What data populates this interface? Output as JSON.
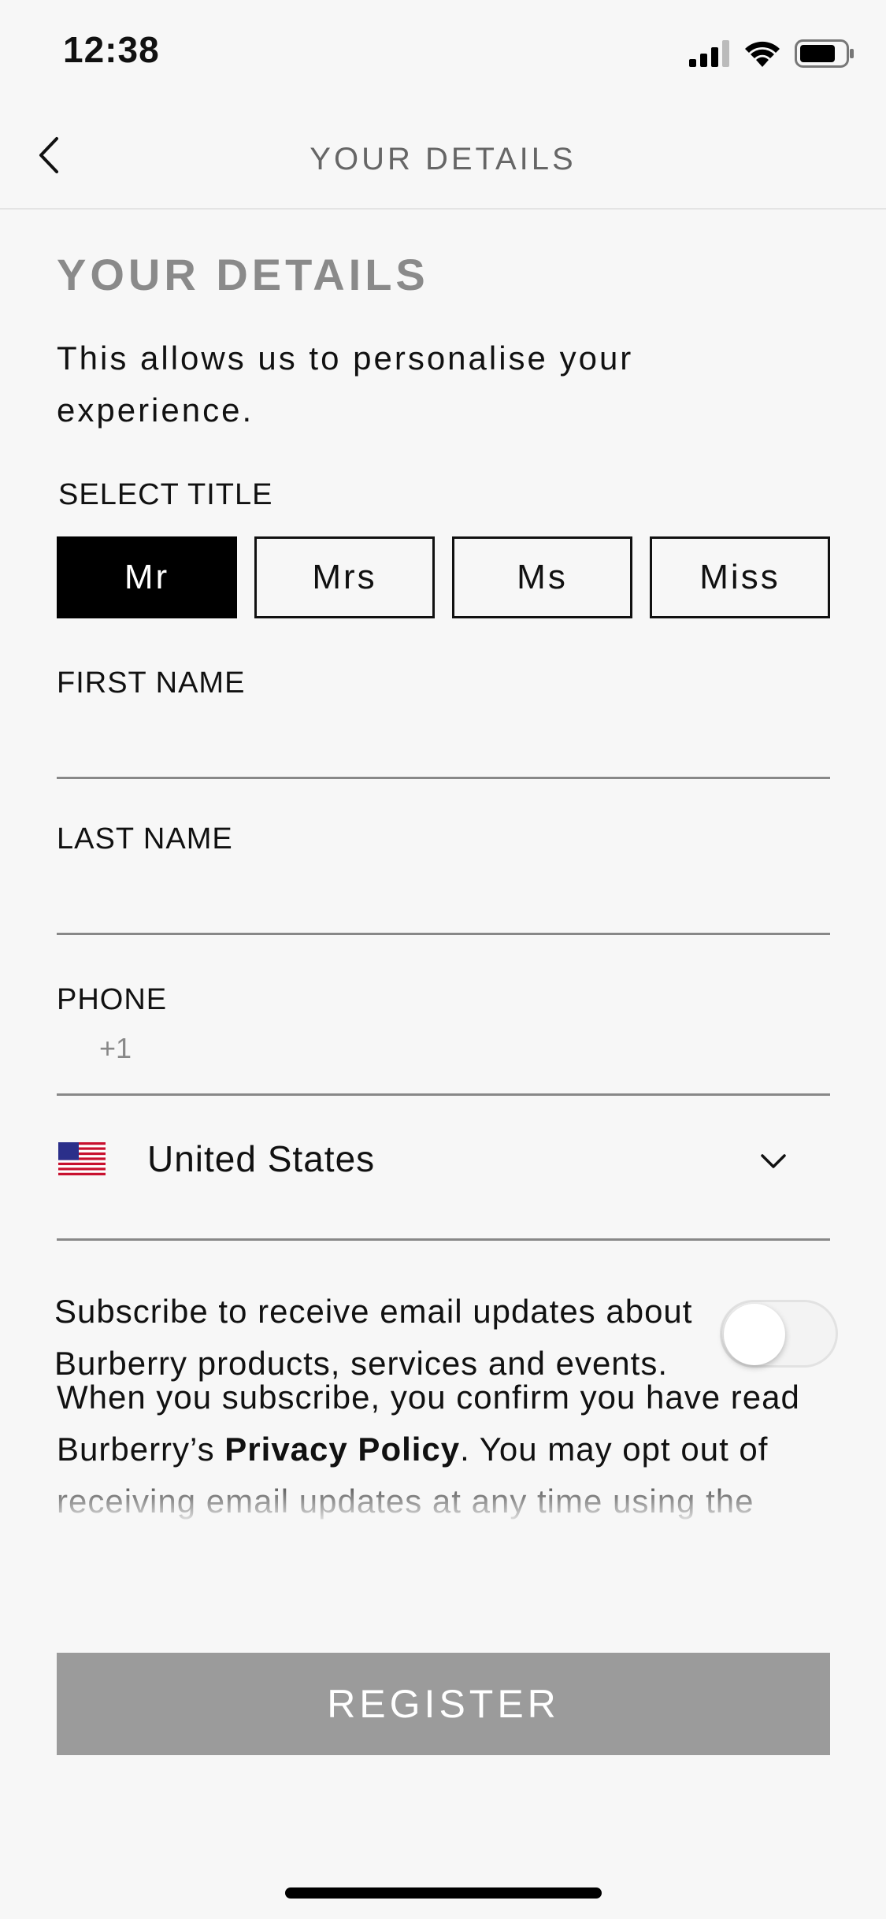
{
  "status_bar": {
    "time": "12:38",
    "icons": [
      "cellular-signal-icon",
      "wifi-icon",
      "battery-icon"
    ]
  },
  "nav": {
    "back_icon": "chevron-left-icon",
    "title": "YOUR DETAILS"
  },
  "form": {
    "heading": "YOUR DETAILS",
    "intro": "This allows us to personalise your experience.",
    "select_title_label": "SELECT TITLE",
    "titles": [
      {
        "label": "Mr",
        "selected": true
      },
      {
        "label": "Mrs",
        "selected": false
      },
      {
        "label": "Ms",
        "selected": false
      },
      {
        "label": "Miss",
        "selected": false
      }
    ],
    "first_name_label": "FIRST NAME",
    "first_name_value": "",
    "last_name_label": "LAST NAME",
    "last_name_value": "",
    "phone_label": "PHONE",
    "phone_prefix": "+1",
    "phone_value": "",
    "country": {
      "flag_icon": "us-flag-icon",
      "name": "United States"
    },
    "subscribe_text": "Subscribe to receive email updates about Burberry products, services and events.",
    "subscribe_enabled": false,
    "privacy": {
      "before": "When you subscribe, you confirm you have read Burberry’s ",
      "link": "Privacy Policy",
      "after": ". You may opt out of receiving email updates at any time using the"
    },
    "register_label": "REGISTER"
  },
  "colors": {
    "background": "#f7f7f7",
    "selected_title": "#000000",
    "register_button": "#9b9b9b",
    "heading": "#8a8a8a"
  }
}
